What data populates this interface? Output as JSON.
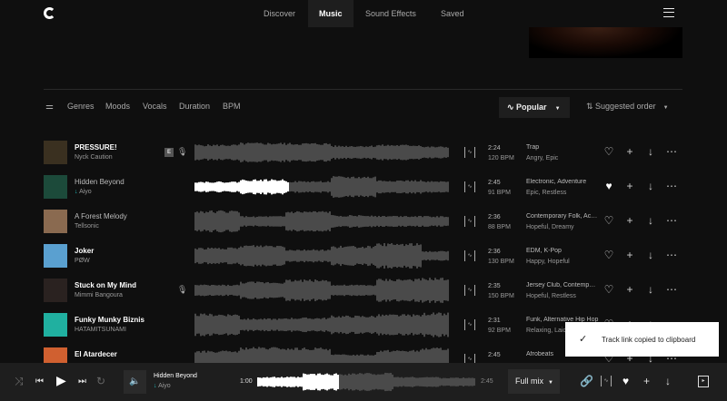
{
  "nav": {
    "items": [
      "Discover",
      "Music",
      "Sound Effects",
      "Saved"
    ],
    "active": 1
  },
  "filters": {
    "items": [
      "Genres",
      "Moods",
      "Vocals",
      "Duration",
      "BPM"
    ],
    "popular": "Popular",
    "sort": "Suggested order"
  },
  "tracks": [
    {
      "title": "PRESSURE!",
      "artist": "Nyck Caution",
      "time": "2:24",
      "bpm": "120 BPM",
      "genres": "Trap",
      "moods": "Angry, Epic",
      "explicit": "E",
      "vocals": true,
      "liked": false,
      "progress": 0,
      "color": "#3a3020",
      "dim": false
    },
    {
      "title": "Hidden Beyond",
      "artist": "Aiyo",
      "time": "2:45",
      "bpm": "91 BPM",
      "genres": "Electronic, Adventure",
      "moods": "Epic, Restless",
      "vocals": false,
      "liked": true,
      "progress": 0.37,
      "color": "#1c4a3a",
      "dim": true,
      "downloaded": true
    },
    {
      "title": "A Forest Melody",
      "artist": "Tellsonic",
      "time": "2:36",
      "bpm": "88 BPM",
      "genres": "Contemporary Folk, Acoustic",
      "moods": "Hopeful, Dreamy",
      "vocals": false,
      "liked": false,
      "progress": 0,
      "color": "#8a6a50",
      "dim": true
    },
    {
      "title": "Joker",
      "artist": "PØW",
      "time": "2:36",
      "bpm": "130 BPM",
      "genres": "EDM, K-Pop",
      "moods": "Happy, Hopeful",
      "vocals": false,
      "liked": false,
      "progress": 0,
      "color": "#5aa0d0",
      "dim": false
    },
    {
      "title": "Stuck on My Mind",
      "artist": "Mimmi Bangoura",
      "time": "2:35",
      "bpm": "150 BPM",
      "genres": "Jersey Club, Contemporary R&B",
      "moods": "Hopeful, Restless",
      "vocals": true,
      "liked": false,
      "progress": 0,
      "color": "#2a2220",
      "dim": false
    },
    {
      "title": "Funky Munky Biznis",
      "artist": "HATAMITSUNAMI",
      "time": "2:31",
      "bpm": "92 BPM",
      "genres": "Funk, Alternative Hip Hop",
      "moods": "Relaxing, Laid Back",
      "vocals": false,
      "liked": false,
      "progress": 0,
      "color": "#20b0a0",
      "dim": false
    },
    {
      "title": "El Atardecer",
      "artist": "",
      "time": "2:45",
      "bpm": "",
      "genres": "Afrobeats",
      "moods": "",
      "vocals": false,
      "liked": false,
      "progress": 0,
      "color": "#d06030",
      "dim": false
    }
  ],
  "toast": {
    "message": "Track link copied to clipboard"
  },
  "player": {
    "title": "Hidden Beyond",
    "artist": "Aiyo",
    "elapsed": "1:00",
    "duration": "2:45",
    "progress": 0.37,
    "mix": "Full mix"
  }
}
